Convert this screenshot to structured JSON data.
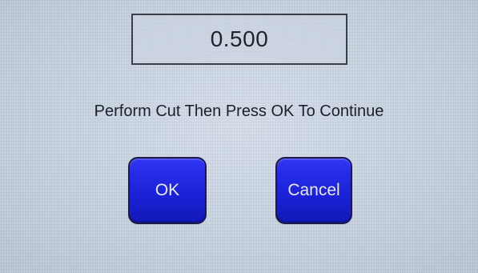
{
  "display": {
    "value": "0.500"
  },
  "prompt": {
    "text": "Perform Cut Then Press OK To Continue"
  },
  "buttons": {
    "ok_label": "OK",
    "cancel_label": "Cancel"
  },
  "colors": {
    "screen_background": "#c3cedc",
    "button_fill": "#1c22d8",
    "button_text": "#e9ecf6",
    "text": "#1c2129"
  }
}
